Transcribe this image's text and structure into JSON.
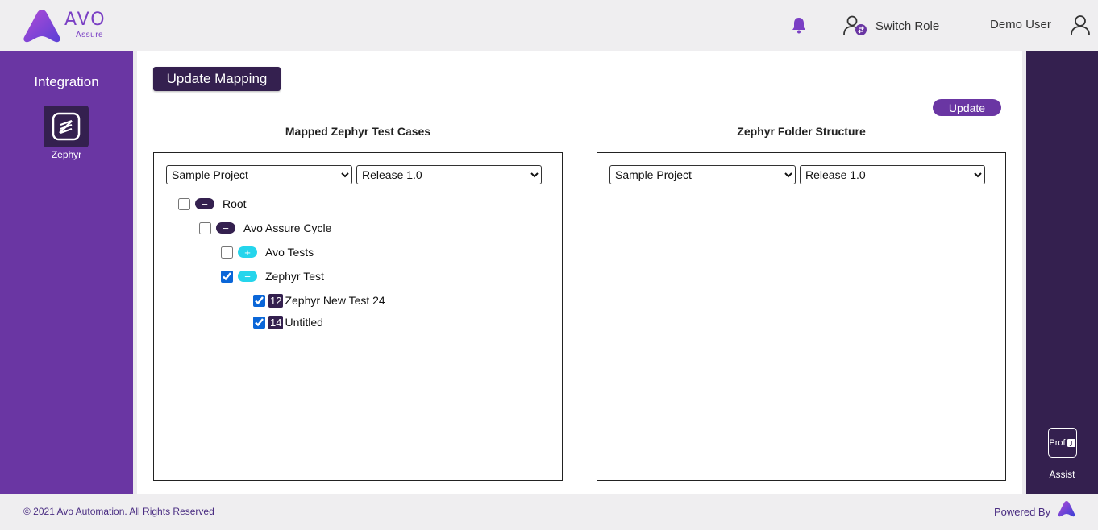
{
  "header": {
    "logo_text": "AVO",
    "logo_subtext": "Assure",
    "switch_role_label": "Switch Role",
    "user_name": "Demo User"
  },
  "sidebar": {
    "title": "Integration",
    "items": [
      {
        "label": "Zephyr",
        "icon": "zephyr-icon"
      }
    ]
  },
  "right_sidebar": {
    "prof_label": "Prof",
    "assist_label": "Assist"
  },
  "main": {
    "update_mapping_label": "Update Mapping",
    "update_label": "Update",
    "left_panel": {
      "title": "Mapped Zephyr Test Cases",
      "project_selected": "Sample Project",
      "release_selected": "Release 1.0"
    },
    "right_panel": {
      "title": "Zephyr Folder Structure",
      "project_selected": "Sample Project",
      "release_selected": "Release 1.0"
    },
    "tree": {
      "root": {
        "label": "Root",
        "checked": false,
        "toggle": "−"
      },
      "cycle": {
        "label": "Avo Assure Cycle",
        "checked": false,
        "toggle": "−"
      },
      "folders": [
        {
          "label": "Avo Tests",
          "checked": false,
          "toggle": "+"
        },
        {
          "label": "Zephyr Test",
          "checked": true,
          "toggle": "−"
        }
      ],
      "testcases": [
        {
          "id": "12",
          "label": "Zephyr New Test 24",
          "checked": true
        },
        {
          "id": "14",
          "label": "Untitled",
          "checked": true
        }
      ]
    }
  },
  "footer": {
    "copyright": "© 2021 Avo Automation. All Rights Reserved",
    "powered_by": "Powered By"
  },
  "colors": {
    "brand_purple": "#6a36a3",
    "dark_purple": "#34204f",
    "cyan": "#25d5ec"
  }
}
